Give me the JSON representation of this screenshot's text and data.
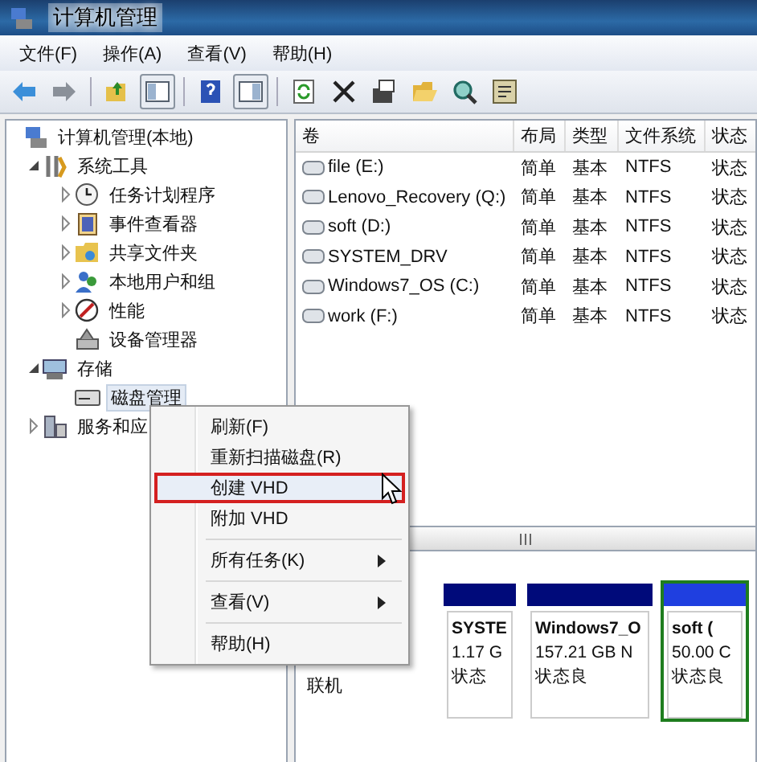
{
  "window": {
    "title": "计算机管理"
  },
  "menu_bar": [
    "文件(F)",
    "操作(A)",
    "查看(V)",
    "帮助(H)"
  ],
  "toolbar": [
    {
      "kind": "button",
      "pressed": false
    },
    {
      "kind": "button",
      "pressed": false
    },
    {
      "kind": "separator"
    },
    {
      "kind": "button",
      "pressed": false
    },
    {
      "kind": "button",
      "pressed": true
    },
    {
      "kind": "separator"
    },
    {
      "kind": "button",
      "pressed": false
    },
    {
      "kind": "button",
      "pressed": true
    },
    {
      "kind": "separator"
    },
    {
      "kind": "button",
      "pressed": false
    },
    {
      "kind": "button",
      "pressed": false
    },
    {
      "kind": "button",
      "pressed": false
    },
    {
      "kind": "button",
      "pressed": false
    },
    {
      "kind": "button",
      "pressed": false
    },
    {
      "kind": "button",
      "pressed": false
    }
  ],
  "tree": [
    {
      "label": "计算机管理(本地)",
      "selected": false,
      "children": [
        {
          "label": "系统工具",
          "selected": false,
          "expanded": true,
          "children": [
            {
              "label": "任务计划程序",
              "selected": false,
              "expanded": false
            },
            {
              "label": "事件查看器",
              "selected": false,
              "expanded": false
            },
            {
              "label": "共享文件夹",
              "selected": false,
              "expanded": false
            },
            {
              "label": "本地用户和组",
              "selected": false,
              "expanded": false
            },
            {
              "label": "性能",
              "selected": false,
              "expanded": false
            },
            {
              "label": "设备管理器",
              "selected": false
            }
          ]
        },
        {
          "label": "存储",
          "selected": false,
          "expanded": true,
          "children": [
            {
              "label": "磁盘管理",
              "selected": true
            }
          ]
        },
        {
          "label": "服务和应",
          "selected": false,
          "expanded": false
        }
      ]
    }
  ],
  "table": {
    "columns": [
      "卷",
      "布局",
      "类型",
      "文件系统",
      "状态"
    ],
    "rows": [
      {
        "cells": [
          "file (E:)",
          "简单",
          "基本",
          "NTFS",
          "状态"
        ]
      },
      {
        "cells": [
          "Lenovo_Recovery (Q:)",
          "简单",
          "基本",
          "NTFS",
          "状态"
        ]
      },
      {
        "cells": [
          "soft (D:)",
          "简单",
          "基本",
          "NTFS",
          "状态"
        ]
      },
      {
        "cells": [
          "SYSTEM_DRV",
          "简单",
          "基本",
          "NTFS",
          "状态"
        ]
      },
      {
        "cells": [
          "Windows7_OS (C:)",
          "简单",
          "基本",
          "NTFS",
          "状态"
        ]
      },
      {
        "cells": [
          "work (F:)",
          "简单",
          "基本",
          "NTFS",
          "状态"
        ]
      }
    ]
  },
  "disk_panel": {
    "status": "联机",
    "partitions": [
      {
        "name": "SYSTE",
        "size": "1.17 G",
        "state": "状态",
        "color": "#000a7a",
        "selected": false
      },
      {
        "name": "Windows7_O",
        "size": "157.21 GB N",
        "state": "状态良",
        "color": "#000a7a",
        "selected": false
      },
      {
        "name": "soft (",
        "size": "50.00 C",
        "state": "状态良",
        "color": "#1f3fe0",
        "selected": true
      }
    ]
  },
  "context_menu": [
    {
      "kind": "command",
      "label": "刷新(F)",
      "selected": false
    },
    {
      "kind": "command",
      "label": "重新扫描磁盘(R)",
      "selected": false
    },
    {
      "kind": "command",
      "label": "创建 VHD",
      "selected": true
    },
    {
      "kind": "command",
      "label": "附加 VHD",
      "selected": false
    },
    {
      "kind": "separator"
    },
    {
      "kind": "submenu",
      "label": "所有任务(K)",
      "selected": false
    },
    {
      "kind": "separator"
    },
    {
      "kind": "submenu",
      "label": "查看(V)",
      "selected": false
    },
    {
      "kind": "separator"
    },
    {
      "kind": "command",
      "label": "帮助(H)",
      "selected": false
    }
  ]
}
